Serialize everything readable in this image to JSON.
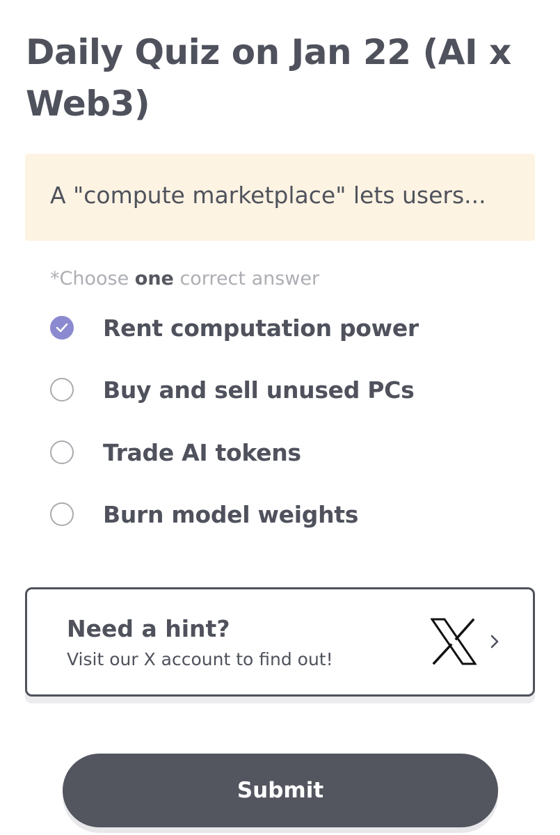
{
  "title": "Daily Quiz on Jan 22 (AI x Web3)",
  "question": "A \"compute marketplace\" lets users...",
  "instruction": {
    "prefix": "*Choose ",
    "emphasis": "one",
    "suffix": " correct answer"
  },
  "options": [
    {
      "label": "Rent computation power",
      "selected": true
    },
    {
      "label": "Buy and sell unused PCs",
      "selected": false
    },
    {
      "label": "Trade AI tokens",
      "selected": false
    },
    {
      "label": "Burn model weights",
      "selected": false
    }
  ],
  "hint": {
    "title": "Need a hint?",
    "subtitle": "Visit our X account to find out!",
    "icon": "x-logo-icon",
    "arrow_icon": "chevron-right-icon"
  },
  "submit_label": "Submit",
  "colors": {
    "text": "#4f525c",
    "accent": "#8b8ad0",
    "question_bg": "#fdf3e2",
    "button_bg": "#53555f"
  }
}
